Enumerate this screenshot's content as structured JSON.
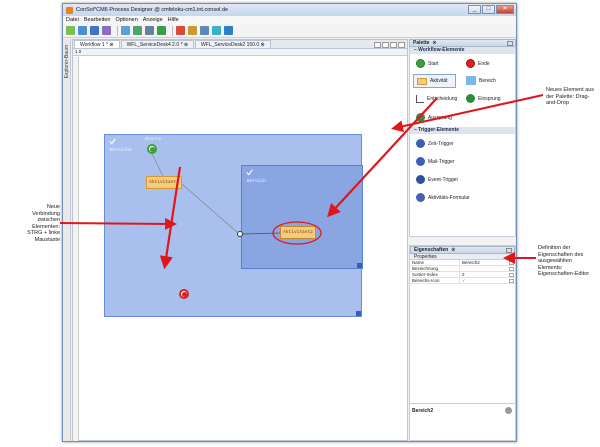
{
  "window": {
    "title": "ConSol*CM6 Process Designer @ cmfeloku-cm1.int.consol.de",
    "btn_min": "_",
    "btn_max": "□",
    "btn_close": "✕"
  },
  "menu": [
    "Datei",
    "Bearbeiten",
    "Optionen",
    "Anzeige",
    "Hilfe"
  ],
  "left_strip": {
    "label": "Explorer-Baum"
  },
  "editor": {
    "tabs": [
      {
        "label": "Workflow 1 *",
        "close": "⊗"
      },
      {
        "label": "WFL_ServiceDesk4 2.0 *",
        "close": "⊗"
      },
      {
        "label": "WFL_ServiceDesk2 150.0",
        "close": "⊗"
      }
    ],
    "ruler_top": "1.0"
  },
  "diagram": {
    "outer_area_label": "Bereich2",
    "inner_area_label": "Bereich",
    "start_label": "Start1",
    "activity1_label": "Aktivitaet1",
    "activity2_label": "Aktivitaet2"
  },
  "palette": {
    "header": "Palette",
    "header_close": "⊗",
    "group1": "Workflow-Elemente",
    "group1_toggle": "–",
    "group2": "Trigger-Elemente",
    "group2_toggle": "–",
    "items": [
      "Start",
      "Ende",
      "Aktivität",
      "Bereich",
      "Entscheidung",
      "Einsprung",
      "Aussprung"
    ],
    "triggers": [
      "Zeit-Trigger",
      "Mail-Trigger",
      "Event-Trigger",
      "Aktivitäts-Formular"
    ]
  },
  "properties": {
    "header": "Eigenschaften",
    "header_close": "⊗",
    "tab": "Properties",
    "rows": [
      {
        "key": "Name",
        "value": "Bereich2"
      },
      {
        "key": "Bezeichnung",
        "value": ""
      },
      {
        "key": "Sortier-Index",
        "value": "2"
      },
      {
        "key": "Bereichs-Icon",
        "value": "✓"
      }
    ]
  },
  "status": {
    "label": "Bereich2"
  },
  "callouts": {
    "palette": "Neues Element aus der Palette: Drag-and-Drop",
    "connection": "Neue Verbindung zwischen Elementen: STRG + linke Maustaste",
    "properties": "Definition der Eigenschaften des ausgewählten Elements: Eigenschaften-Editor"
  },
  "colors": {
    "arrow": "#e0161b",
    "area_outer": "#a9c0ee",
    "area_inner": "#8aa6e2",
    "activity": "#f9c97c"
  }
}
